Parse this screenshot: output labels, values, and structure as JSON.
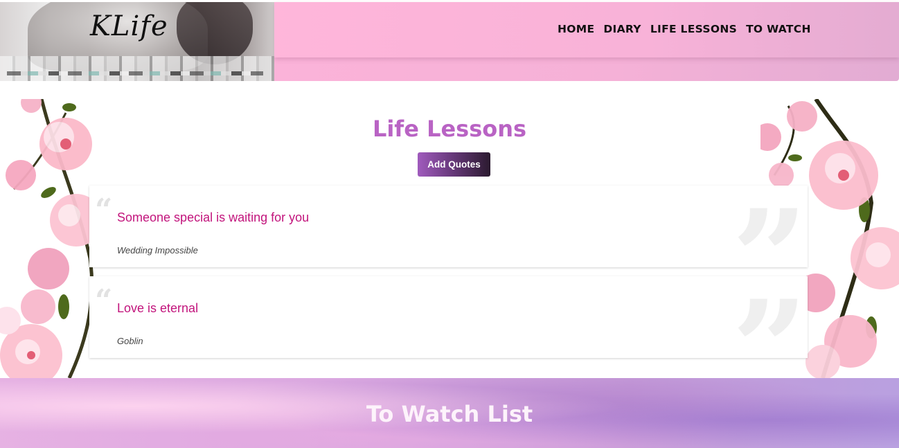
{
  "header": {
    "logo": "KLife",
    "nav": [
      {
        "label": "HOME"
      },
      {
        "label": "DIARY"
      },
      {
        "label": "LIFE LESSONS"
      },
      {
        "label": "TO WATCH"
      }
    ]
  },
  "lessons": {
    "title": "Life Lessons",
    "add_button": "Add Quotes",
    "quotes": [
      {
        "text": "Someone special is waiting for you",
        "source": "Wedding Impossible"
      },
      {
        "text": "Love is eternal",
        "source": "Goblin"
      }
    ]
  },
  "watch": {
    "title": "To Watch List"
  },
  "colors": {
    "header_pink": "#fbb3d9",
    "title_purple": "#b963c4",
    "quote_text": "#c2147c"
  }
}
